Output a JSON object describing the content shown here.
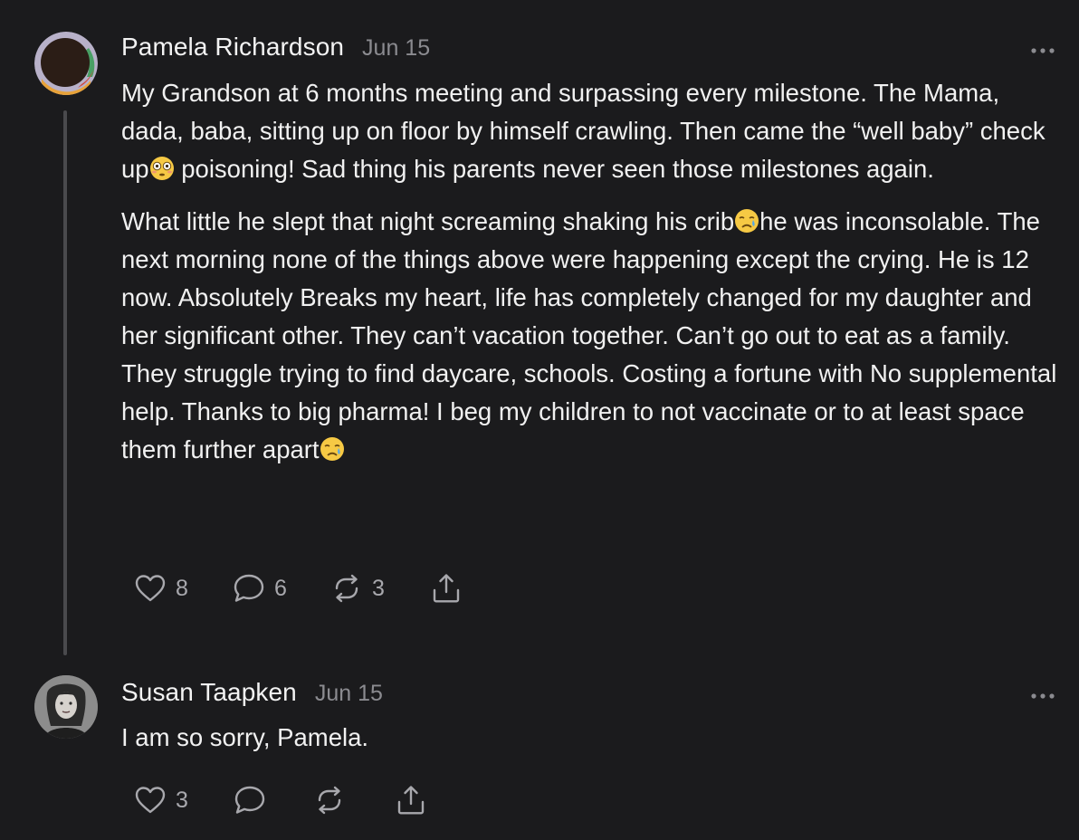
{
  "comments": [
    {
      "author": "Pamela Richardson",
      "date": "Jun 15",
      "paragraphs": [
        {
          "before_emoji": "My Grandson at 6 months meeting and surpassing every milestone. The Mama, dada, baba, sitting up on floor by himself crawling. Then came the “well baby” check up",
          "emoji": "flushed-face",
          "after_emoji": " poisoning! Sad thing his parents never seen those milestones again."
        },
        {
          "before_emoji": "What little he slept that night screaming shaking his crib",
          "emoji": "crying-face",
          "after_emoji": "he was inconsolable. The next morning none of the things above were happening except the crying. He is 12 now. Absolutely Breaks my heart, life has completely changed for my daughter and her significant other. They can’t vacation together. Can’t go out to eat as a family. They struggle trying to find daycare, schools. Costing a fortune with No supplemental help. Thanks to big pharma! I beg my children to not vaccinate or to at least space them further apart",
          "end_emoji": "crying-face"
        }
      ],
      "likes": "8",
      "replies": "6",
      "reposts": "3",
      "icons": [
        "heart-icon",
        "comment-icon",
        "repost-icon",
        "share-icon",
        "more-icon"
      ]
    },
    {
      "author": "Susan Taapken",
      "date": "Jun 15",
      "text": "I am so sorry, Pamela.",
      "likes": "3",
      "icons": [
        "heart-icon",
        "comment-icon",
        "repost-icon",
        "share-icon",
        "more-icon"
      ]
    }
  ],
  "colors": {
    "background": "#1b1b1d",
    "text": "#f1f1f1",
    "muted": "#8b8b90",
    "thread_line": "#4a4a4d"
  }
}
